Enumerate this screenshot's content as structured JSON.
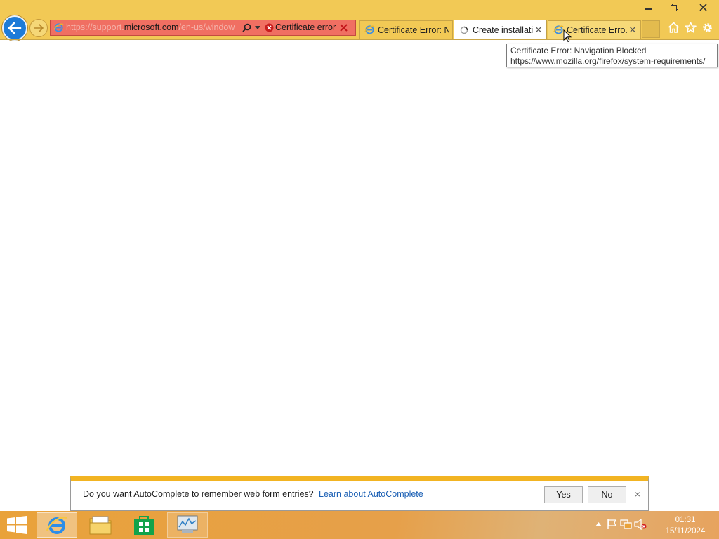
{
  "browser": {
    "address": {
      "url_prefix": "https://support.",
      "url_host": "microsoft.com",
      "url_path": "/en-us/window",
      "status_text": "Certificate error"
    },
    "tabs": [
      {
        "label": "Certificate Error: N...",
        "state": "inactive"
      },
      {
        "label": "Create installati...",
        "state": "active-loading"
      },
      {
        "label": "Certificate Erro...",
        "state": "hovered"
      }
    ],
    "tooltip": {
      "title": "Certificate Error: Navigation Blocked",
      "url": "https://www.mozilla.org/firefox/system-requirements/"
    },
    "toolbar_icons": [
      "home-icon",
      "star-icon",
      "gear-icon"
    ]
  },
  "notification": {
    "message": "Do you want AutoComplete to remember web form entries?",
    "link": "Learn about AutoComplete",
    "yes_label": "Yes",
    "no_label": "No"
  },
  "taskbar": {
    "apps": [
      "internet-explorer",
      "file-explorer",
      "store",
      "performance-monitor"
    ],
    "clock": {
      "time": "01:31",
      "date": "15/11/2024"
    }
  },
  "colors": {
    "chrome": "#f2c955",
    "address_error": "#f06f62",
    "notification_accent": "#f2b422",
    "link": "#1a5fb4",
    "taskbar": "#e9a23a"
  }
}
